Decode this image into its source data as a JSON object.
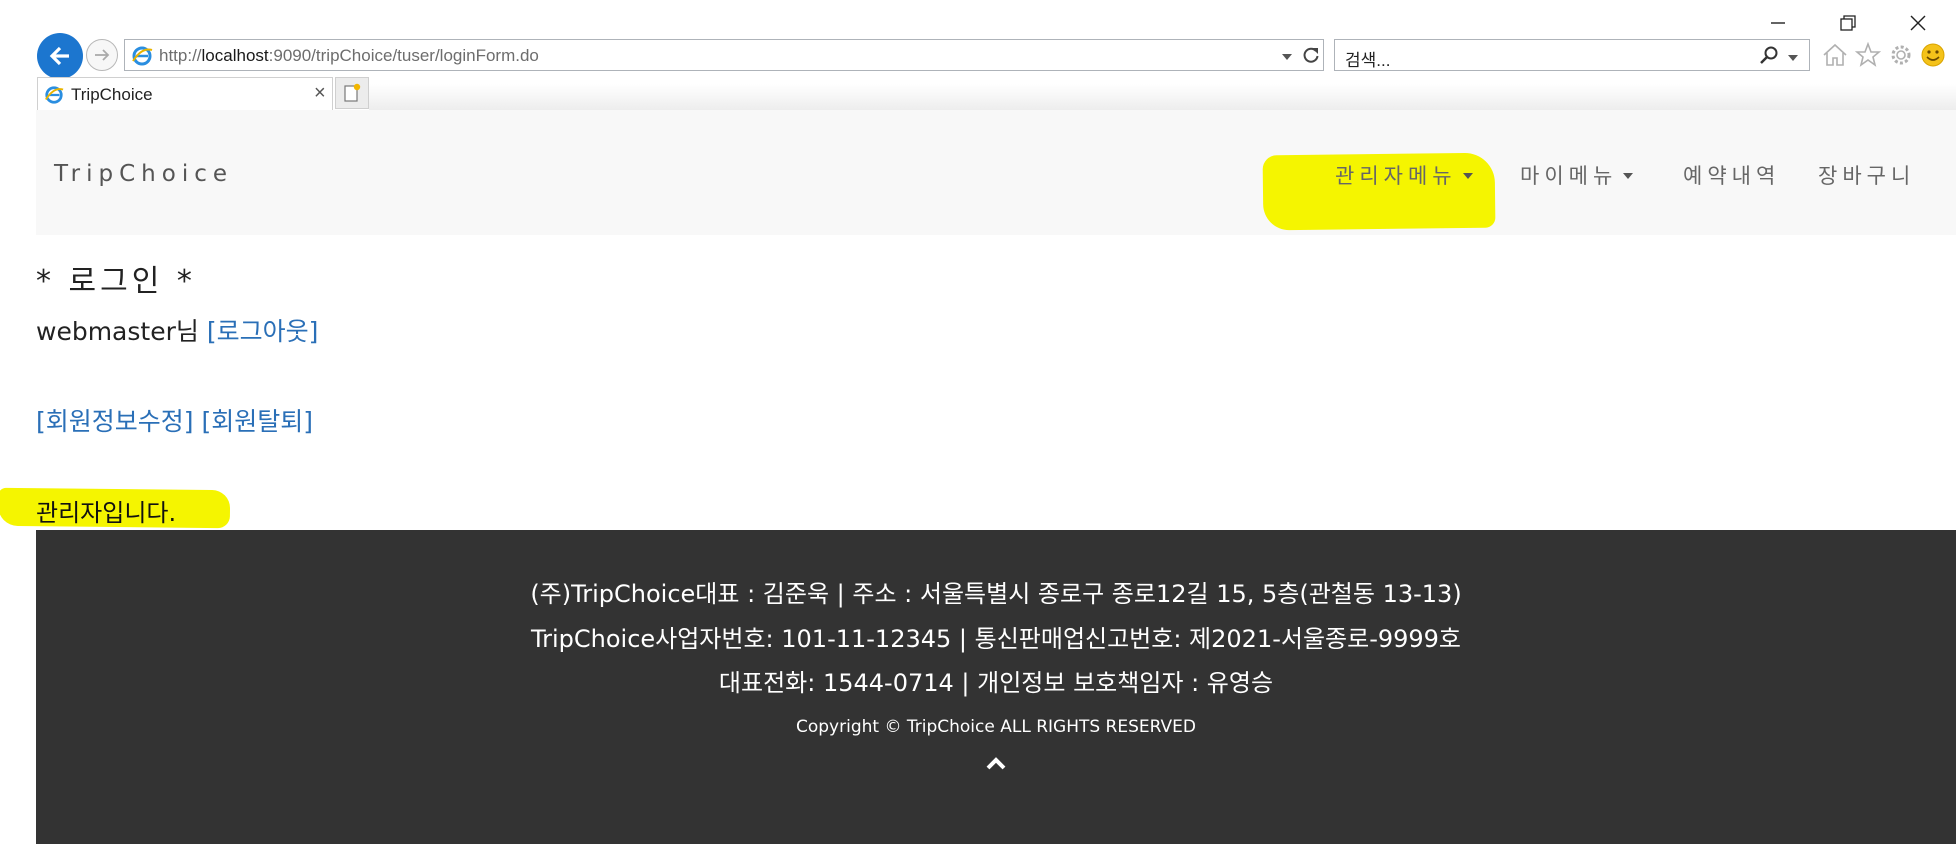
{
  "browser": {
    "address": {
      "prefix": "http://",
      "host": "localhost",
      "path": ":9090/tripChoice/tuser/loginForm.do"
    },
    "search": {
      "placeholder": "검색..."
    },
    "tab": {
      "title": "TripChoice",
      "close": "×"
    },
    "icons": [
      "back-arrow-icon",
      "forward-arrow-icon",
      "ie-icon",
      "refresh-icon",
      "search-icon",
      "home-icon",
      "star-icon",
      "gear-icon",
      "smiley-icon",
      "new-tab-icon"
    ],
    "accent": "#1c76cf"
  },
  "navbar": {
    "brand": "TripChoice",
    "items": [
      {
        "label": "관리자메뉴",
        "dropdown": true,
        "highlighted": true
      },
      {
        "label": "마이메뉴",
        "dropdown": true
      },
      {
        "label": "예약내역",
        "dropdown": false
      },
      {
        "label": "장바구니",
        "dropdown": false
      }
    ]
  },
  "main": {
    "heading": "* 로그인 *",
    "user_name": "webmaster님",
    "logout_link": "[로그아웃]",
    "edit_link": "[회원정보수정]",
    "withdraw_link": "[회원탈퇴]",
    "admin_notice": "관리자입니다."
  },
  "footer": {
    "line1": "(주)TripChoice대표 : 김준욱 | 주소 : 서울특별시 종로구 종로12길 15, 5층(관철동 13-13)",
    "line2": "TripChoice사업자번호: 101-11-12345 | 통신판매업신고번호: 제2021-서울종로-9999호",
    "line3": "대표전화: 1544-0714 | 개인정보 보호책임자 : 유영승",
    "copyright": "Copyright © TripChoice ALL RIGHTS RESERVED"
  },
  "colors": {
    "highlight": "#f5f500",
    "link": "#2a6fb7",
    "footer_bg": "#333333",
    "navbar_bg": "#f8f8f8"
  }
}
